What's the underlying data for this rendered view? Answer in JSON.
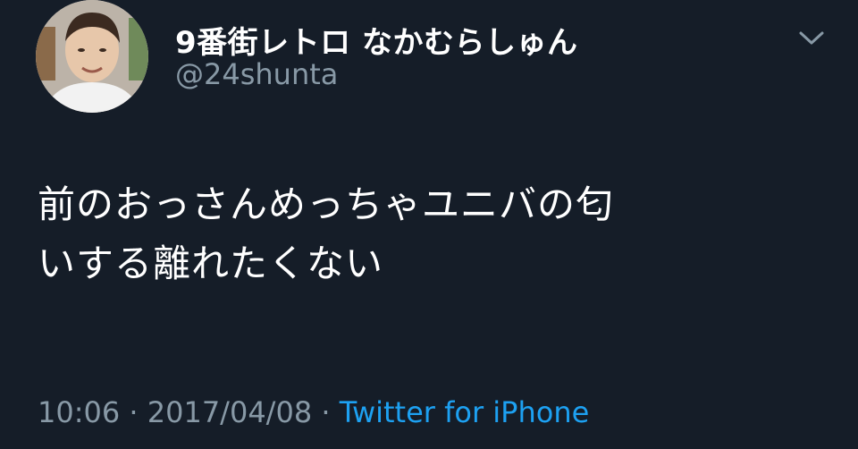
{
  "user": {
    "display_name": "9番街レトロ なかむらしゅん",
    "handle": "@24shunta",
    "avatar_icon": "user-avatar-photo"
  },
  "tweet": {
    "text_lines": [
      "前のおっさんめっちゃユニバの匂",
      "いする離れたくない"
    ],
    "time": "10:06",
    "date": "2017/04/08",
    "separator": "·",
    "source": "Twitter for iPhone"
  },
  "menu": {
    "icon": "chevron-down-icon"
  },
  "colors": {
    "background": "#151d28",
    "text": "#ffffff",
    "secondary": "#8899a6",
    "link": "#1da1f2"
  }
}
